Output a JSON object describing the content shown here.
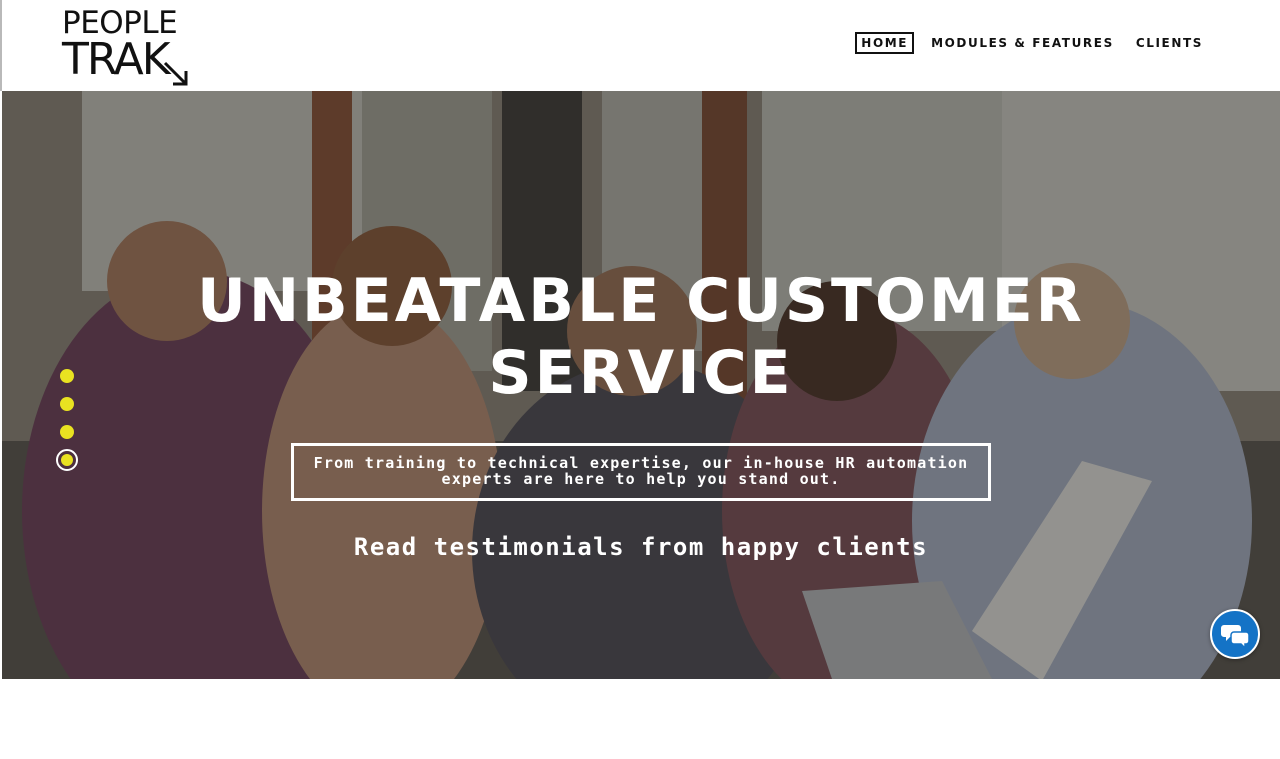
{
  "logo": {
    "line1": "PEOPLE",
    "line2": "TRAK",
    "icon": "arrow-down-right-icon"
  },
  "nav": {
    "items": [
      {
        "label": "HOME",
        "active": true
      },
      {
        "label": "MODULES & FEATURES",
        "active": false
      },
      {
        "label": "CLIENTS",
        "active": false
      }
    ]
  },
  "hero": {
    "title_line1": "UNBEATABLE CUSTOMER",
    "title_line2": "SERVICE",
    "box_line1": "From training to technical expertise, our in-house HR automation",
    "box_line2": "experts are here to help you stand out.",
    "link": "Read testimonials from happy clients",
    "slides_total": 4,
    "active_slide": 4
  },
  "chat": {
    "icon": "chat-bubbles-icon"
  },
  "colors": {
    "accent_yellow": "#e9e221",
    "chat_blue": "#1473c6",
    "text_dark": "#111111"
  }
}
